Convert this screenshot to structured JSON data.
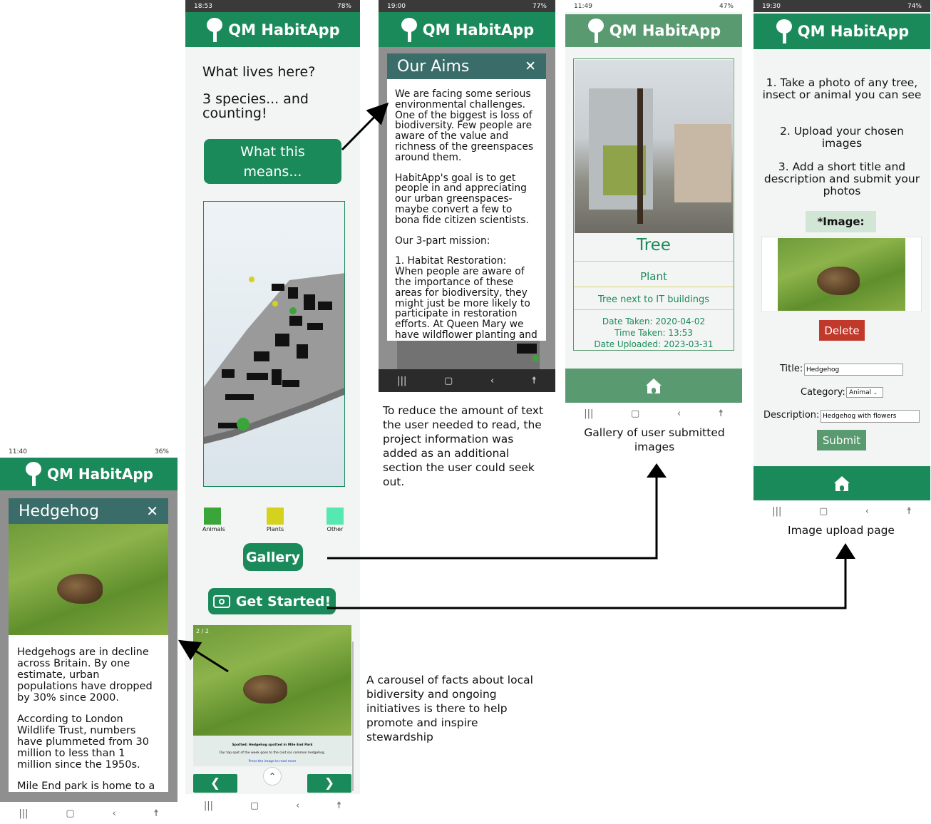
{
  "app_title": "QM HabitApp",
  "colors": {
    "brand": "#1b8a5a",
    "modal_header": "#3a6d6a",
    "delete": "#c0392b",
    "submit": "#5a9a70"
  },
  "screen_hedgehog": {
    "status_time": "11:40",
    "status_battery": "36%",
    "modal_title": "Hedgehog",
    "close_icon": "✕",
    "body_paragraphs": [
      "Hedgehogs are in decline across Britain. By one estimate, urban populations have dropped by 30% since 2000.",
      "According to London Wildlife Trust, numbers have plummeted from 30 million to less than 1 million since the 1950s.",
      "Mile End park is home to a"
    ]
  },
  "screen_home": {
    "status_time": "18:53",
    "status_battery": "78%",
    "heading": "What lives here?",
    "species_count": "3 species... and counting!",
    "what_button": "What this means...",
    "legend": [
      {
        "label": "Animals",
        "color": "#3aa63a"
      },
      {
        "label": "Plants",
        "color": "#d4d21c"
      },
      {
        "label": "Other",
        "color": "#55e8b0"
      }
    ],
    "gallery_button": "Gallery",
    "get_started_button": "Get Started!",
    "carousel": {
      "counter": "2 / 2",
      "caption_title": "Spotted: Hedgehog spotted in Mile End Park",
      "caption_text": "Our top spot of the week goes to the (not so) common hedgehog.",
      "caption_link": "Press the image to read more",
      "prev": "❮",
      "next": "❯",
      "up": "⌃"
    }
  },
  "screen_aims": {
    "status_time": "19:00",
    "status_battery": "77%",
    "modal_title": "Our Aims",
    "close_icon": "✕",
    "paragraphs": [
      "We are facing some serious environmental challenges. One of the biggest is loss of biodiversity. Few people are aware of the value and richness of the greenspaces around them.",
      "HabitApp's goal is to get people in and appreciating our urban greenspaces- maybe convert a few to bona fide citizen scientists.",
      "Our 3-part mission:",
      "1. Habitat Restoration: When people are aware of the importance of these areas for biodiversity, they might just be more likely to participate in restoration efforts. At Queen Mary we have wildflower planting and"
    ]
  },
  "screen_gallery": {
    "status_time": "11:49",
    "status_battery": "47%",
    "card_title": "Tree",
    "card_category": "Plant",
    "card_description": "Tree next to IT buildings",
    "date_taken": "Date Taken: 2020-04-02",
    "time_taken": "Time Taken: 13:53",
    "date_uploaded": "Date Uploaded: 2023-03-31"
  },
  "screen_upload": {
    "status_time": "19:30",
    "status_battery": "74%",
    "steps": [
      "1. Take a photo of any tree, insect or animal you can see",
      "2. Upload your chosen images",
      "3. Add a short title and description and submit your photos"
    ],
    "image_label": "*Image:",
    "delete_button": "Delete",
    "title_label": "Title:",
    "title_value": "Hedgehog",
    "category_label": "Category:",
    "category_value": "Animal",
    "description_label": "Description:",
    "description_value": "Hedgehog with flowers",
    "submit_button": "Submit"
  },
  "annotations": {
    "aims_note": "To reduce the amount of text the user needed to read, the project information was added as an additional section the user could seek out.",
    "gallery_note": "Gallery of user submitted images",
    "upload_note": "Image upload page",
    "carousel_note": "A carousel of facts about local bidiversity and ongoing initiatives is there to help promote and inspire stewardship"
  }
}
